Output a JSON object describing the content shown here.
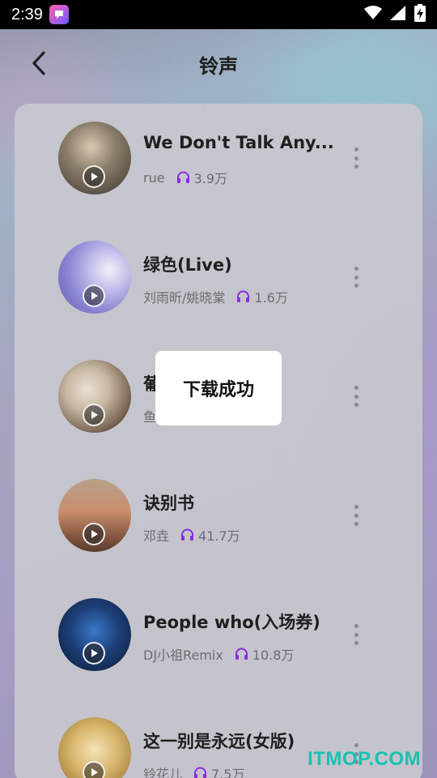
{
  "status_bar": {
    "time": "2:39",
    "icons": [
      "app-notification-icon",
      "wifi-icon",
      "signal-icon",
      "battery-charging-icon"
    ]
  },
  "header": {
    "title": "铃声",
    "back_icon": "chevron-left-icon"
  },
  "songs": [
    {
      "title": "We Don't Talk Any...",
      "artist": "rue",
      "plays": "3.9万"
    },
    {
      "title": "绿色(Live)",
      "artist": "刘雨昕/姚晓棠",
      "plays": "1.6万"
    },
    {
      "title": "葡",
      "artist": "鱼",
      "plays": ""
    },
    {
      "title": "诀别书",
      "artist": "邓垚",
      "plays": "41.7万"
    },
    {
      "title": "People who(入场券)",
      "artist": "DJ小祖Remix",
      "plays": "10.8万"
    },
    {
      "title": "这一别是永远(女版)",
      "artist": "铃花儿",
      "plays": "7.5万"
    }
  ],
  "toast": {
    "message": "下载成功"
  },
  "watermark": "ITMOP.COM",
  "colors": {
    "accent_headphones": "#8a2be2",
    "watermark": "#17c2b2"
  }
}
